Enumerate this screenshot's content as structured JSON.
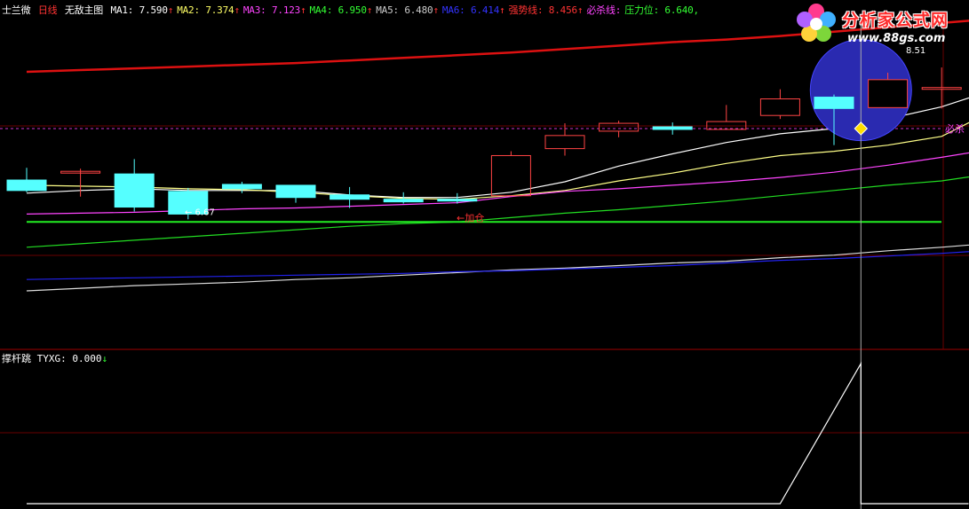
{
  "header": {
    "stock_name": "士兰微",
    "period": "日线",
    "formula_name": "无敌主图",
    "items": [
      {
        "label": "MA1: 7.590",
        "arrow": "↑",
        "color": "#ffffff"
      },
      {
        "label": "MA2: 7.374",
        "arrow": "↑",
        "color": "#ffff66"
      },
      {
        "label": "MA3: 7.123",
        "arrow": "↑",
        "color": "#ff44ff"
      },
      {
        "label": "MA4: 6.950",
        "arrow": "↑",
        "color": "#33ff33"
      },
      {
        "label": "MA5: 6.480",
        "arrow": "↑",
        "color": "#cccccc"
      },
      {
        "label": "MA6: 6.414",
        "arrow": "↑",
        "color": "#3333ff"
      },
      {
        "label": "强势线: 8.456",
        "arrow": "↑",
        "color": "#ff3333"
      },
      {
        "label": "必杀线:",
        "arrow": "",
        "color": "#ff44ff"
      },
      {
        "label": "压力位: 6.640,",
        "arrow": "",
        "color": "#33ff33"
      }
    ]
  },
  "sub_header": {
    "indicator_name": "撑杆跳",
    "value_label": "TYXG: 0.000",
    "arrow": "↓"
  },
  "logo": {
    "name": "分析家公式网",
    "url": "www.88gs.com"
  },
  "annotations": {
    "low_label": "← 6.67",
    "add_position": "←加仓",
    "bisha_right": "必杀",
    "top_right_value": "8.51"
  },
  "colors": {
    "up": "#ff4444",
    "down": "#55ffff",
    "strong_line": "#dd1111",
    "ma1": "#ffffff",
    "ma2": "#ffff88",
    "ma3": "#ff44ff",
    "ma4": "#22dd22",
    "ma5": "#dddddd",
    "ma6": "#2222ee",
    "pressure": "#22ee22",
    "bisha": "#cc33cc",
    "grid": "#6a0000",
    "circle": "#2a2ab0"
  },
  "chart_data": {
    "type": "candlestick",
    "price_range": [
      5.2,
      9.0
    ],
    "candles": [
      {
        "o": 7.12,
        "h": 7.26,
        "l": 6.98,
        "c": 7.0
      },
      {
        "o": 7.22,
        "h": 7.25,
        "l": 6.93,
        "c": 7.22
      },
      {
        "o": 7.19,
        "h": 7.36,
        "l": 6.76,
        "c": 6.81
      },
      {
        "o": 6.99,
        "h": 7.03,
        "l": 6.67,
        "c": 6.73
      },
      {
        "o": 7.07,
        "h": 7.1,
        "l": 6.97,
        "c": 7.02
      },
      {
        "o": 7.06,
        "h": 7.06,
        "l": 6.86,
        "c": 6.92
      },
      {
        "o": 6.95,
        "h": 7.04,
        "l": 6.8,
        "c": 6.9
      },
      {
        "o": 6.9,
        "h": 6.98,
        "l": 6.85,
        "c": 6.87
      },
      {
        "o": 6.9,
        "h": 6.97,
        "l": 6.85,
        "c": 6.88
      },
      {
        "o": 6.94,
        "h": 7.45,
        "l": 6.94,
        "c": 7.4
      },
      {
        "o": 7.48,
        "h": 7.77,
        "l": 7.4,
        "c": 7.63
      },
      {
        "o": 7.68,
        "h": 7.8,
        "l": 7.61,
        "c": 7.77
      },
      {
        "o": 7.73,
        "h": 7.78,
        "l": 7.64,
        "c": 7.7
      },
      {
        "o": 7.7,
        "h": 7.98,
        "l": 7.7,
        "c": 7.79
      },
      {
        "o": 7.86,
        "h": 8.16,
        "l": 7.82,
        "c": 8.05
      },
      {
        "o": 8.07,
        "h": 8.1,
        "l": 7.52,
        "c": 7.94
      },
      {
        "o": 7.95,
        "h": 8.35,
        "l": 7.95,
        "c": 8.27
      },
      {
        "o": 8.17,
        "h": 8.41,
        "l": 7.94,
        "c": 8.18
      },
      {
        "o": 8.25,
        "h": 8.75,
        "l": 8.25,
        "c": 8.65
      }
    ],
    "series": [
      {
        "name": "强势线",
        "values": [
          8.36,
          8.38,
          8.4,
          8.42,
          8.44,
          8.46,
          8.49,
          8.52,
          8.55,
          8.58,
          8.62,
          8.66,
          8.7,
          8.73,
          8.77,
          8.82,
          8.87,
          8.92,
          8.97
        ]
      },
      {
        "name": "MA1",
        "values": [
          6.97,
          7.0,
          7.02,
          7.0,
          7.0,
          7.0,
          6.95,
          6.92,
          6.92,
          6.98,
          7.1,
          7.28,
          7.42,
          7.55,
          7.65,
          7.71,
          7.82,
          7.96,
          8.16
        ]
      },
      {
        "name": "MA2",
        "values": [
          7.06,
          7.05,
          7.04,
          7.02,
          7.01,
          6.98,
          6.94,
          6.91,
          6.9,
          6.94,
          7.0,
          7.11,
          7.2,
          7.31,
          7.4,
          7.45,
          7.52,
          7.62,
          7.93
        ]
      },
      {
        "name": "MA3",
        "values": [
          6.73,
          6.74,
          6.75,
          6.77,
          6.79,
          6.8,
          6.82,
          6.84,
          6.86,
          6.93,
          6.99,
          7.02,
          7.06,
          7.1,
          7.15,
          7.21,
          7.29,
          7.38,
          7.48
        ]
      },
      {
        "name": "MA4",
        "values": [
          6.35,
          6.39,
          6.43,
          6.47,
          6.51,
          6.55,
          6.59,
          6.62,
          6.64,
          6.69,
          6.74,
          6.78,
          6.83,
          6.88,
          6.94,
          7.0,
          7.06,
          7.11,
          7.2
        ]
      },
      {
        "name": "MA5",
        "values": [
          5.85,
          5.88,
          5.91,
          5.93,
          5.95,
          5.98,
          6.0,
          6.03,
          6.06,
          6.09,
          6.11,
          6.14,
          6.17,
          6.19,
          6.23,
          6.26,
          6.31,
          6.35,
          6.4
        ]
      },
      {
        "name": "MA6",
        "values": [
          5.98,
          5.99,
          6.0,
          6.01,
          6.02,
          6.03,
          6.04,
          6.05,
          6.07,
          6.08,
          6.1,
          6.12,
          6.14,
          6.17,
          6.2,
          6.22,
          6.25,
          6.28,
          6.32
        ]
      }
    ],
    "pressure_level": 6.64,
    "bisha_level": 7.71,
    "selected_index": 15,
    "tyxg": {
      "range": [
        0,
        1
      ],
      "values": [
        0,
        0,
        0,
        0,
        0,
        0,
        0,
        0,
        0,
        0,
        0,
        0,
        0,
        0,
        0,
        1,
        0,
        0,
        0
      ]
    }
  }
}
